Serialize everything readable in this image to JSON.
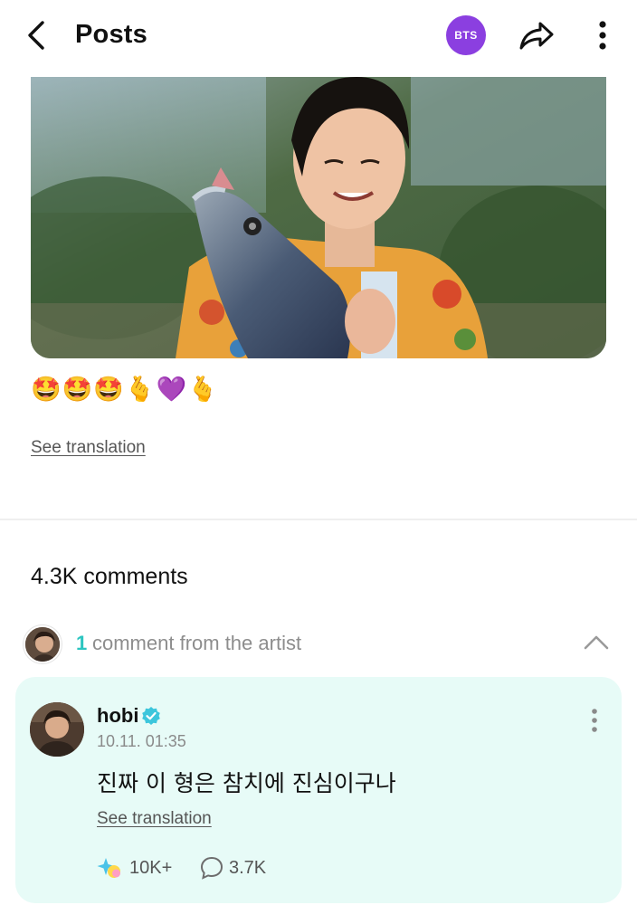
{
  "header": {
    "title": "Posts",
    "community_badge": "BTS",
    "badge_color": "#8b3fe0"
  },
  "post": {
    "text": "🤩🤩🤩🫰💜🫰",
    "see_translation": "See translation"
  },
  "comments": {
    "count_label": "4.3K comments",
    "artist_section": {
      "count": "1",
      "label": "comment from the artist",
      "accent_color": "#2cc5c0"
    },
    "artist_comment": {
      "author": "hobi",
      "timestamp": "10.11. 01:35",
      "text": "진짜 이 형은 참치에 진심이구나",
      "see_translation": "See translation",
      "likes": "10K+",
      "replies": "3.7K",
      "card_color": "#e7fbf7"
    }
  },
  "icons": {
    "back": "chevron-left-icon",
    "share": "share-icon",
    "more": "more-vertical-icon",
    "collapse": "chevron-up-icon",
    "verified": "verified-badge-icon",
    "like": "sparkle-like-icon",
    "reply": "speech-bubble-icon"
  }
}
